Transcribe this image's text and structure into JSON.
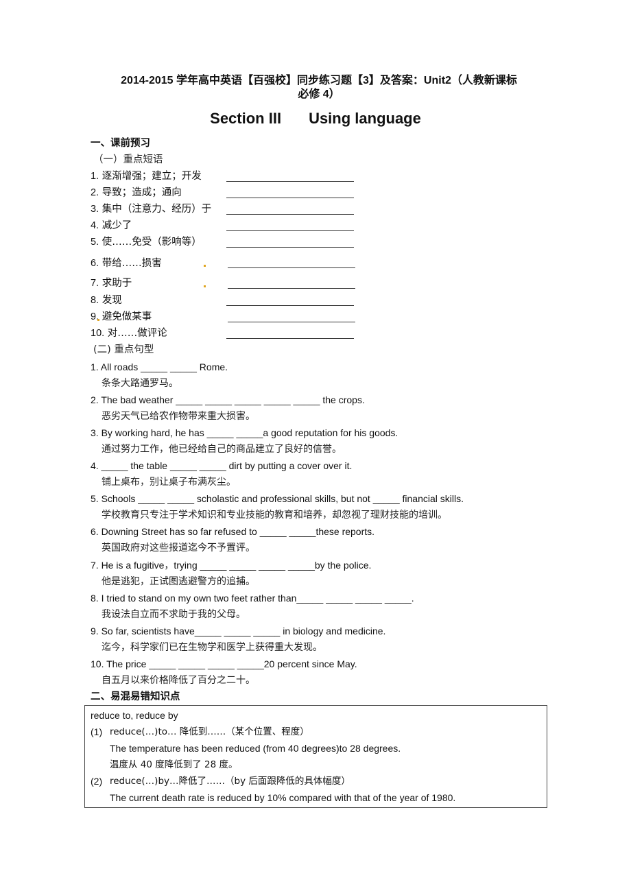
{
  "document": {
    "title_line1": "2014-2015 学年高中英语【百强校】同步练习题【3】及答案：Unit2（人教新课标",
    "title_line2": "必修 4）",
    "section_label": "Section III",
    "section_name": "Using language"
  },
  "part1": {
    "heading": "一、课前预习",
    "phrases": {
      "heading": "（一）重点短语",
      "items": [
        {
          "num": "1.",
          "text": "逐渐增强；建立；开发",
          "blank": ""
        },
        {
          "num": "2.",
          "text": "导致；造成；通向",
          "blank": ""
        },
        {
          "num": "3.",
          "text": "集中（注意力、经历）于",
          "blank": ""
        },
        {
          "num": "4.",
          "text": "减少了",
          "blank": ""
        },
        {
          "num": "5.",
          "text": "使……免受（影响等）",
          "blank": ""
        },
        {
          "num": "6.",
          "text": "带给……损害",
          "blank": ""
        },
        {
          "num": "7.",
          "text": "求助于",
          "blank": ""
        },
        {
          "num": "8.",
          "text": "发现",
          "blank": ""
        },
        {
          "num": "9.",
          "text": "避免做某事",
          "blank": ""
        },
        {
          "num": "10.",
          "text": "对……做评论",
          "blank": ""
        }
      ]
    },
    "sentences": {
      "heading": "(二)  重点句型",
      "items": [
        {
          "en": "1. All roads _____ _____ Rome.",
          "zh": "条条大路通罗马。"
        },
        {
          "en": "2. The bad weather _____ _____ _____ _____ _____ the crops.",
          "zh": "恶劣天气已给农作物带来重大损害。"
        },
        {
          "en": "3. By working hard, he has _____ _____a good reputation for his goods.",
          "zh": "通过努力工作，他已经给自己的商品建立了良好的信誉。"
        },
        {
          "en": "4. _____ the table _____ _____ dirt by putting a cover over it.",
          "zh": "铺上桌布，别让桌子布满灰尘。"
        },
        {
          "en": "5. Schools _____ _____ scholastic and professional skills, but not _____ financial skills.",
          "zh": "学校教育只专注于学术知识和专业技能的教育和培养，却忽视了理财技能的培训。"
        },
        {
          "en": "6. Downing Street has so far refused to _____ _____these reports.",
          "zh": "英国政府对这些报道迄今不予置评。"
        },
        {
          "en": "7. He is a fugitive，trying _____ _____ _____ _____by the police.",
          "zh": "他是逃犯，正试图逃避警方的追捕。"
        },
        {
          "en": "8. I tried to stand on my own two feet rather than_____ _____ _____ _____.",
          "zh": "我设法自立而不求助于我的父母。"
        },
        {
          "en": "9. So far, scientists have_____ _____ _____ in biology and medicine.",
          "zh": "迄今，科学家们已在生物学和医学上获得重大发现。"
        },
        {
          "en": "10. The price _____ _____ _____ _____20 percent since May.",
          "zh": "自五月以来价格降低了百分之二十。"
        }
      ]
    }
  },
  "part2": {
    "heading": "二、易混易错知识点",
    "box": {
      "title": "reduce to, reduce by",
      "entries": [
        {
          "num": "(1)",
          "usage": "reduce(…)to…  降低到……（某个位置、程度）",
          "example_en": "The temperature has been reduced (from 40 degrees)to 28 degrees.",
          "example_zh": "温度从 40 度降低到了 28 度。"
        },
        {
          "num": "(2)",
          "usage": "reduce(…)by…降低了……（by 后面跟降低的具体幅度）",
          "example_en": "The current death rate is reduced by 10% compared with that of the year of 1980."
        }
      ]
    }
  }
}
